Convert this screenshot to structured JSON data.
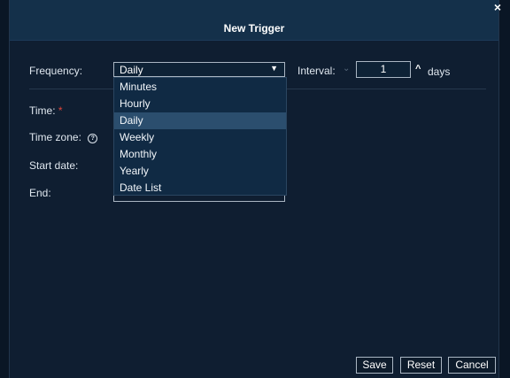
{
  "dialog": {
    "title": "New Trigger",
    "close_glyph": "×"
  },
  "form": {
    "frequency_label": "Frequency:",
    "frequency_value": "Daily",
    "interval_label": "Interval:",
    "interval_value": "1",
    "interval_unit": "days",
    "time_label": "Time:",
    "required_mark": "*",
    "timezone_label": "Time zone:",
    "startdate_label": "Start date:",
    "end_label": "End:"
  },
  "frequency_options": [
    "Minutes",
    "Hourly",
    "Daily",
    "Weekly",
    "Monthly",
    "Yearly",
    "Date List"
  ],
  "selected_option": "Daily",
  "buttons": {
    "save": "Save",
    "reset": "Reset",
    "cancel": "Cancel"
  },
  "icons": {
    "close": "close-icon",
    "help": "help-circle-icon",
    "dropdown_caret": "caret-down-icon",
    "interval_down": "chevron-down-icon",
    "interval_up": "chevron-up-icon"
  }
}
